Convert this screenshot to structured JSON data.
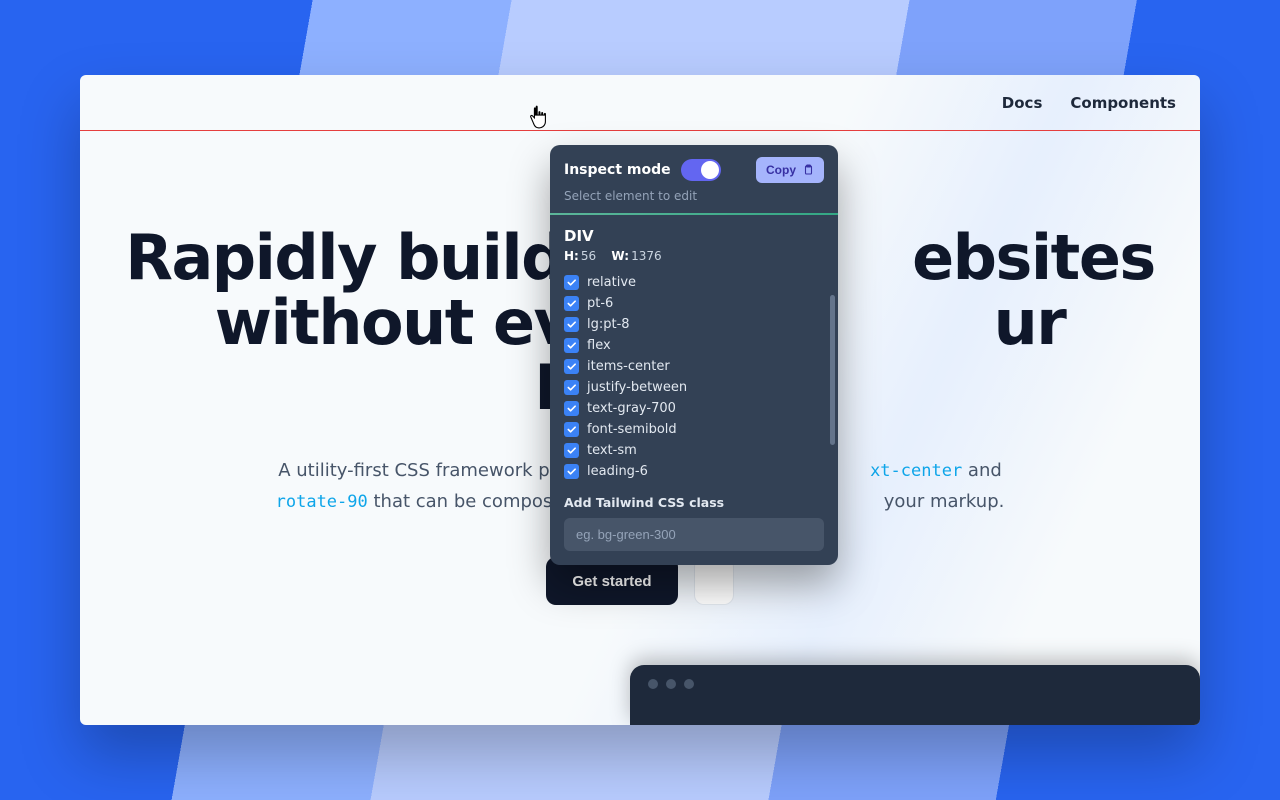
{
  "header": {
    "nav": [
      {
        "label": "Docs"
      },
      {
        "label": "Components"
      }
    ]
  },
  "hero": {
    "title_line1": "Rapidly build",
    "title_mid": "ebsites",
    "title_line2_a": "without ever le",
    "title_line2_b": "ur HTML.",
    "subtext_a": "A utility-first CSS framework packed",
    "code_a": "xt-center",
    "subtext_b": "and",
    "code_b": "rotate-90",
    "subtext_c": "that can be compose",
    "subtext_d": "your markup.",
    "cta_primary": "Get started"
  },
  "inspector": {
    "title": "Inspect mode",
    "toggle_on": true,
    "copy_label": "Copy",
    "subtitle": "Select element to edit",
    "element_tag": "DIV",
    "height_label": "H:",
    "height_value": "56",
    "width_label": "W:",
    "width_value": "1376",
    "classes": [
      "relative",
      "pt-6",
      "lg:pt-8",
      "flex",
      "items-center",
      "justify-between",
      "text-gray-700",
      "font-semibold",
      "text-sm",
      "leading-6"
    ],
    "add_label": "Add Tailwind CSS class",
    "add_placeholder": "eg. bg-green-300"
  },
  "icons": {
    "hand_cursor": "hand-cursor-icon",
    "clipboard": "clipboard-icon",
    "check": "check-icon",
    "window_dot": "window-dot-icon"
  }
}
